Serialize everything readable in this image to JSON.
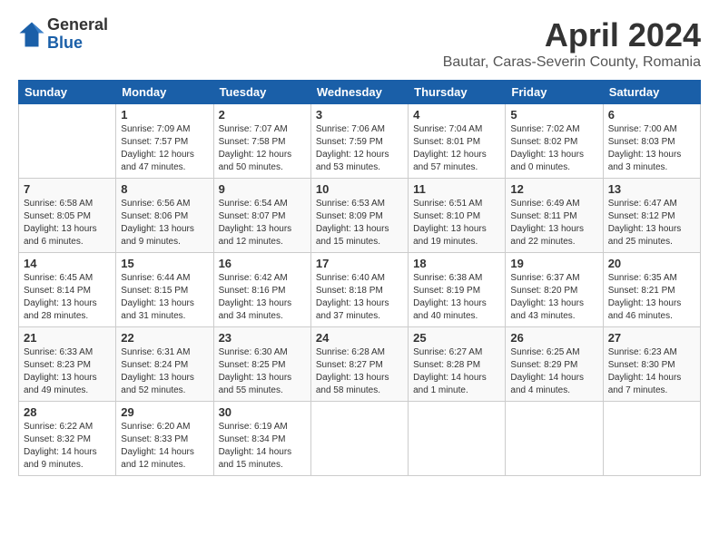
{
  "logo": {
    "general": "General",
    "blue": "Blue"
  },
  "title": "April 2024",
  "subtitle": "Bautar, Caras-Severin County, Romania",
  "headers": [
    "Sunday",
    "Monday",
    "Tuesday",
    "Wednesday",
    "Thursday",
    "Friday",
    "Saturday"
  ],
  "weeks": [
    [
      {
        "day": "",
        "info": ""
      },
      {
        "day": "1",
        "info": "Sunrise: 7:09 AM\nSunset: 7:57 PM\nDaylight: 12 hours\nand 47 minutes."
      },
      {
        "day": "2",
        "info": "Sunrise: 7:07 AM\nSunset: 7:58 PM\nDaylight: 12 hours\nand 50 minutes."
      },
      {
        "day": "3",
        "info": "Sunrise: 7:06 AM\nSunset: 7:59 PM\nDaylight: 12 hours\nand 53 minutes."
      },
      {
        "day": "4",
        "info": "Sunrise: 7:04 AM\nSunset: 8:01 PM\nDaylight: 12 hours\nand 57 minutes."
      },
      {
        "day": "5",
        "info": "Sunrise: 7:02 AM\nSunset: 8:02 PM\nDaylight: 13 hours\nand 0 minutes."
      },
      {
        "day": "6",
        "info": "Sunrise: 7:00 AM\nSunset: 8:03 PM\nDaylight: 13 hours\nand 3 minutes."
      }
    ],
    [
      {
        "day": "7",
        "info": "Sunrise: 6:58 AM\nSunset: 8:05 PM\nDaylight: 13 hours\nand 6 minutes."
      },
      {
        "day": "8",
        "info": "Sunrise: 6:56 AM\nSunset: 8:06 PM\nDaylight: 13 hours\nand 9 minutes."
      },
      {
        "day": "9",
        "info": "Sunrise: 6:54 AM\nSunset: 8:07 PM\nDaylight: 13 hours\nand 12 minutes."
      },
      {
        "day": "10",
        "info": "Sunrise: 6:53 AM\nSunset: 8:09 PM\nDaylight: 13 hours\nand 15 minutes."
      },
      {
        "day": "11",
        "info": "Sunrise: 6:51 AM\nSunset: 8:10 PM\nDaylight: 13 hours\nand 19 minutes."
      },
      {
        "day": "12",
        "info": "Sunrise: 6:49 AM\nSunset: 8:11 PM\nDaylight: 13 hours\nand 22 minutes."
      },
      {
        "day": "13",
        "info": "Sunrise: 6:47 AM\nSunset: 8:12 PM\nDaylight: 13 hours\nand 25 minutes."
      }
    ],
    [
      {
        "day": "14",
        "info": "Sunrise: 6:45 AM\nSunset: 8:14 PM\nDaylight: 13 hours\nand 28 minutes."
      },
      {
        "day": "15",
        "info": "Sunrise: 6:44 AM\nSunset: 8:15 PM\nDaylight: 13 hours\nand 31 minutes."
      },
      {
        "day": "16",
        "info": "Sunrise: 6:42 AM\nSunset: 8:16 PM\nDaylight: 13 hours\nand 34 minutes."
      },
      {
        "day": "17",
        "info": "Sunrise: 6:40 AM\nSunset: 8:18 PM\nDaylight: 13 hours\nand 37 minutes."
      },
      {
        "day": "18",
        "info": "Sunrise: 6:38 AM\nSunset: 8:19 PM\nDaylight: 13 hours\nand 40 minutes."
      },
      {
        "day": "19",
        "info": "Sunrise: 6:37 AM\nSunset: 8:20 PM\nDaylight: 13 hours\nand 43 minutes."
      },
      {
        "day": "20",
        "info": "Sunrise: 6:35 AM\nSunset: 8:21 PM\nDaylight: 13 hours\nand 46 minutes."
      }
    ],
    [
      {
        "day": "21",
        "info": "Sunrise: 6:33 AM\nSunset: 8:23 PM\nDaylight: 13 hours\nand 49 minutes."
      },
      {
        "day": "22",
        "info": "Sunrise: 6:31 AM\nSunset: 8:24 PM\nDaylight: 13 hours\nand 52 minutes."
      },
      {
        "day": "23",
        "info": "Sunrise: 6:30 AM\nSunset: 8:25 PM\nDaylight: 13 hours\nand 55 minutes."
      },
      {
        "day": "24",
        "info": "Sunrise: 6:28 AM\nSunset: 8:27 PM\nDaylight: 13 hours\nand 58 minutes."
      },
      {
        "day": "25",
        "info": "Sunrise: 6:27 AM\nSunset: 8:28 PM\nDaylight: 14 hours\nand 1 minute."
      },
      {
        "day": "26",
        "info": "Sunrise: 6:25 AM\nSunset: 8:29 PM\nDaylight: 14 hours\nand 4 minutes."
      },
      {
        "day": "27",
        "info": "Sunrise: 6:23 AM\nSunset: 8:30 PM\nDaylight: 14 hours\nand 7 minutes."
      }
    ],
    [
      {
        "day": "28",
        "info": "Sunrise: 6:22 AM\nSunset: 8:32 PM\nDaylight: 14 hours\nand 9 minutes."
      },
      {
        "day": "29",
        "info": "Sunrise: 6:20 AM\nSunset: 8:33 PM\nDaylight: 14 hours\nand 12 minutes."
      },
      {
        "day": "30",
        "info": "Sunrise: 6:19 AM\nSunset: 8:34 PM\nDaylight: 14 hours\nand 15 minutes."
      },
      {
        "day": "",
        "info": ""
      },
      {
        "day": "",
        "info": ""
      },
      {
        "day": "",
        "info": ""
      },
      {
        "day": "",
        "info": ""
      }
    ]
  ]
}
